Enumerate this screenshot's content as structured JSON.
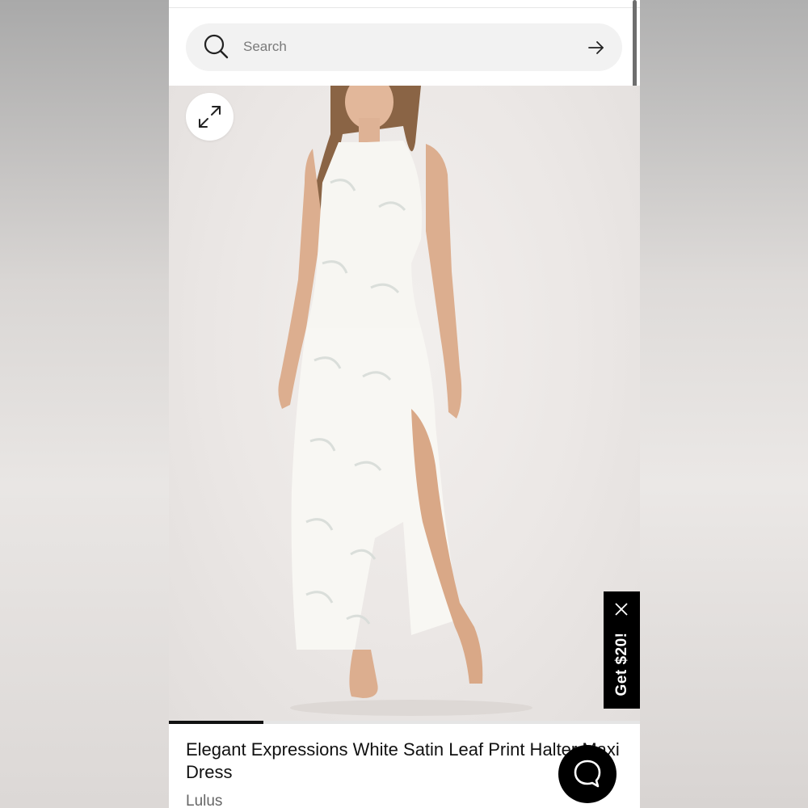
{
  "search": {
    "placeholder": "Search"
  },
  "promo": {
    "label": "Get $20!"
  },
  "carousel": {
    "current_fraction": 0.2
  },
  "product": {
    "title": "Elegant Expressions White Satin Leaf Print Halter Maxi Dress",
    "brand": "Lulus"
  },
  "icons": {
    "search": "search-icon",
    "submit": "arrow-right-icon",
    "expand": "expand-icon",
    "close": "close-icon",
    "chat": "chat-bubble-icon"
  },
  "colors": {
    "accent": "#000000",
    "search_bg": "#f2f2f2",
    "image_bg": "#ebe7e5"
  }
}
